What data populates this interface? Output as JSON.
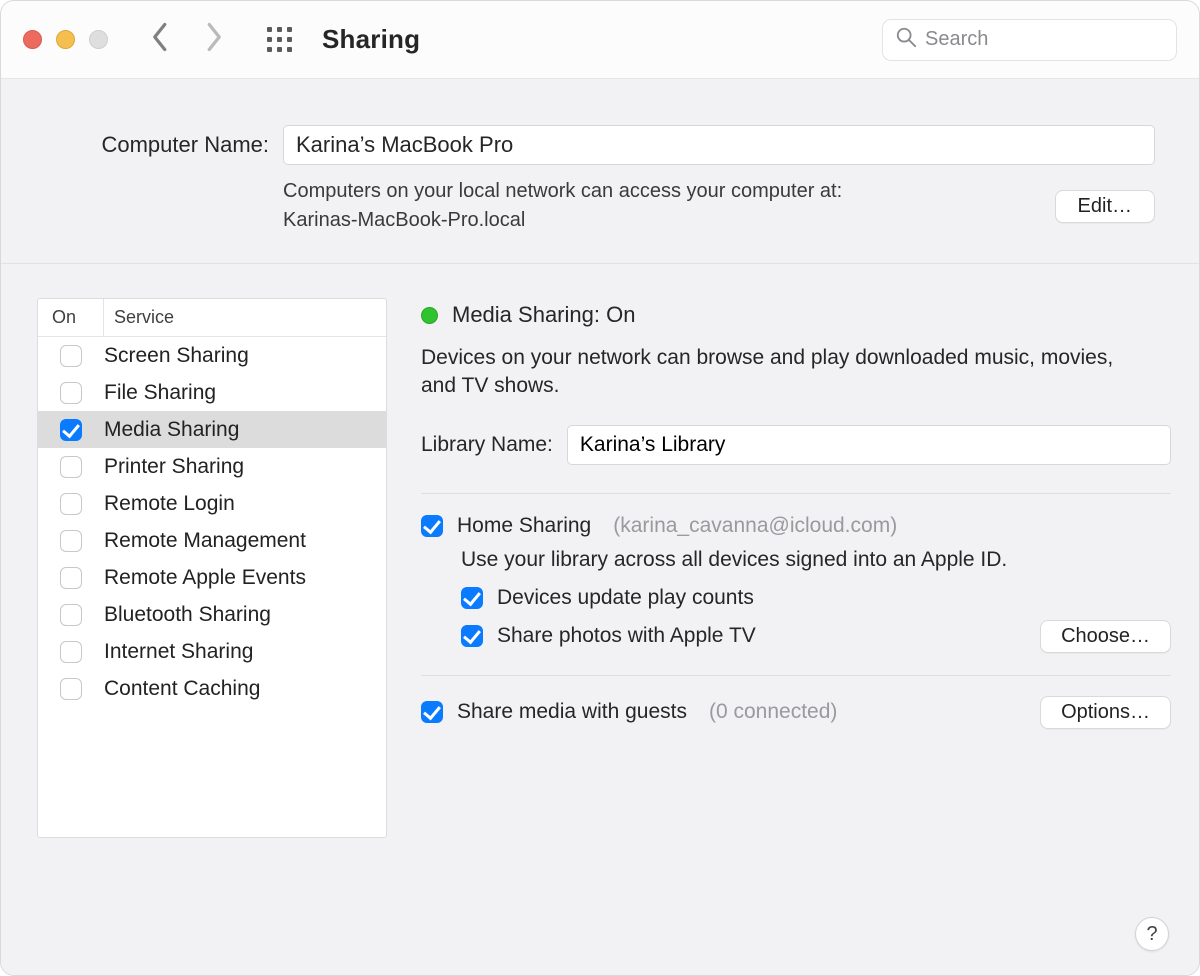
{
  "window": {
    "title": "Sharing"
  },
  "search": {
    "placeholder": "Search"
  },
  "computer_name": {
    "label": "Computer Name:",
    "value": "Karina’s MacBook Pro",
    "subtext_line1": "Computers on your local network can access your computer at:",
    "subtext_line2": "Karinas-MacBook-Pro.local",
    "edit_label": "Edit…"
  },
  "service_list": {
    "header_on": "On",
    "header_service": "Service",
    "items": [
      {
        "label": "Screen Sharing",
        "checked": false,
        "selected": false
      },
      {
        "label": "File Sharing",
        "checked": false,
        "selected": false
      },
      {
        "label": "Media Sharing",
        "checked": true,
        "selected": true
      },
      {
        "label": "Printer Sharing",
        "checked": false,
        "selected": false
      },
      {
        "label": "Remote Login",
        "checked": false,
        "selected": false
      },
      {
        "label": "Remote Management",
        "checked": false,
        "selected": false
      },
      {
        "label": "Remote Apple Events",
        "checked": false,
        "selected": false
      },
      {
        "label": "Bluetooth Sharing",
        "checked": false,
        "selected": false
      },
      {
        "label": "Internet Sharing",
        "checked": false,
        "selected": false
      },
      {
        "label": "Content Caching",
        "checked": false,
        "selected": false
      }
    ]
  },
  "detail": {
    "status_title": "Media Sharing: On",
    "status_desc": "Devices on your network can browse and play downloaded music, movies, and TV shows.",
    "library_label": "Library Name:",
    "library_value": "Karina’s Library",
    "home_sharing": {
      "label": "Home Sharing",
      "account": "(karina_cavanna@icloud.com)",
      "desc": "Use your library across all devices signed into an Apple ID.",
      "play_counts_label": "Devices update play counts",
      "photos_label": "Share photos with Apple TV",
      "choose_label": "Choose…"
    },
    "guests": {
      "label": "Share media with guests",
      "count": "(0 connected)",
      "options_label": "Options…"
    }
  },
  "help_label": "?"
}
